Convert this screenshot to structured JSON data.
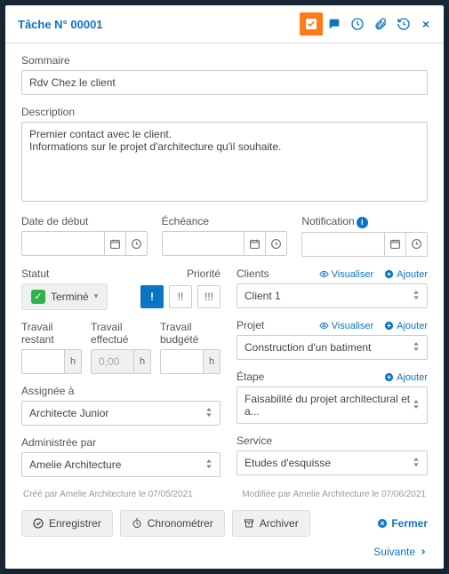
{
  "header": {
    "title": "Tâche N° 00001"
  },
  "summary": {
    "label": "Sommaire",
    "value": "Rdv Chez le client"
  },
  "description": {
    "label": "Description",
    "value": "Premier contact avec le client.\nInformations sur le projet d'architecture qu'il souhaite."
  },
  "dates": {
    "start": {
      "label": "Date de début",
      "value": ""
    },
    "due": {
      "label": "Échéance",
      "value": ""
    },
    "notif": {
      "label": "Notification",
      "value": ""
    }
  },
  "status": {
    "label": "Statut",
    "value": "Terminé"
  },
  "priority": {
    "label": "Priorité",
    "options": [
      "!",
      "!!",
      "!!!"
    ],
    "selected_index": 0
  },
  "work": {
    "remaining": {
      "label": "Travail restant",
      "value": "",
      "unit": "h"
    },
    "done": {
      "label": "Travail effectué",
      "value": "0,00",
      "unit": "h"
    },
    "budget": {
      "label": "Travail budgété",
      "value": "",
      "unit": "h"
    }
  },
  "assignee": {
    "label": "Assignée à",
    "value": "Architecte Junior"
  },
  "admin": {
    "label": "Administrée par",
    "value": "Amelie Architecture"
  },
  "clients": {
    "label": "Clients",
    "value": "Client 1"
  },
  "project": {
    "label": "Projet",
    "value": "Construction d'un batiment"
  },
  "step": {
    "label": "Étape",
    "value": "Faisabilité du projet architectural et a..."
  },
  "service": {
    "label": "Service",
    "value": "Etudes d'esquisse"
  },
  "links": {
    "view": "Visualiser",
    "add": "Ajouter"
  },
  "meta": {
    "created": "Créé par Amelie Architecture le 07/05/2021",
    "modified": "Modifiée par Amelie Architecture le 07/06/2021"
  },
  "buttons": {
    "save": "Enregistrer",
    "timer": "Chronométrer",
    "archive": "Archiver",
    "close": "Fermer",
    "next": "Suivante"
  }
}
